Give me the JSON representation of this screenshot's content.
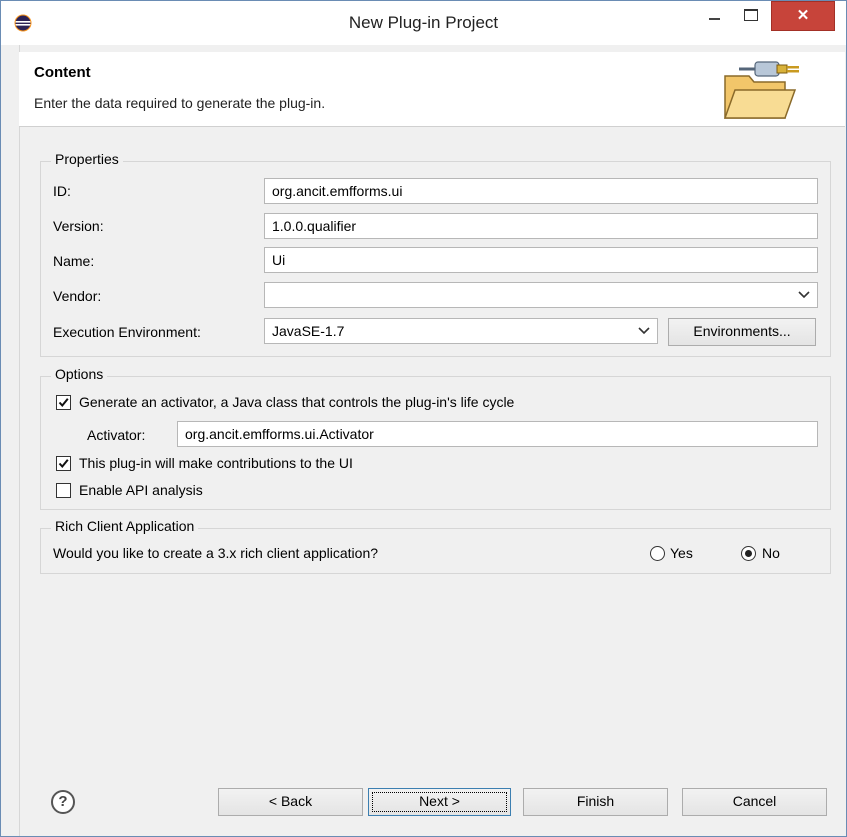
{
  "window": {
    "title": "New Plug-in Project",
    "close_glyph": "✕",
    "close_color": "#c7443a"
  },
  "header": {
    "title": "Content",
    "description": "Enter the data required to generate the plug-in.",
    "icon": "folder-plug-icon"
  },
  "properties": {
    "legend": "Properties",
    "id_label": "ID:",
    "id_value": "org.ancit.emfforms.ui",
    "version_label": "Version:",
    "version_value": "1.0.0.qualifier",
    "name_label": "Name:",
    "name_value": "Ui",
    "vendor_label": "Vendor:",
    "vendor_value": "",
    "ee_label": "Execution Environment:",
    "ee_value": "JavaSE-1.7",
    "environments_button": "Environments..."
  },
  "options": {
    "legend": "Options",
    "generate_activator_label": "Generate an activator, a Java class that controls the plug-in's life cycle",
    "generate_activator_checked": true,
    "activator_label": "Activator:",
    "activator_value": "org.ancit.emfforms.ui.Activator",
    "ui_contributions_label": "This plug-in will make contributions to the UI",
    "ui_contributions_checked": true,
    "api_analysis_label": "Enable API analysis",
    "api_analysis_checked": false
  },
  "rcp": {
    "legend": "Rich Client Application",
    "question": "Would you like to create a 3.x rich client application?",
    "yes_label": "Yes",
    "no_label": "No",
    "selected": "No"
  },
  "buttons": {
    "help": "?",
    "back": "< Back",
    "next": "Next >",
    "finish": "Finish",
    "cancel": "Cancel"
  }
}
